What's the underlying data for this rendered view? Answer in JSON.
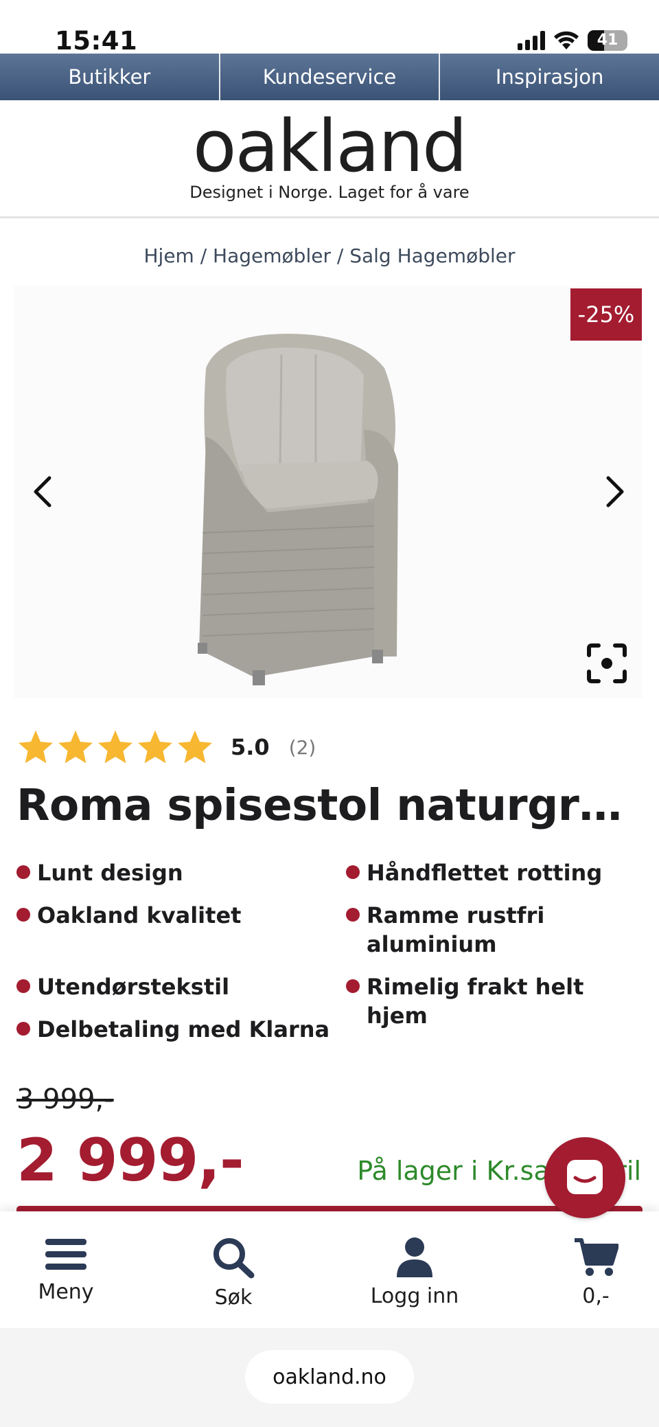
{
  "status_bar": {
    "time": "15:41",
    "battery": "41"
  },
  "top_nav": {
    "items": [
      "Butikker",
      "Kundeservice",
      "Inspirasjon"
    ]
  },
  "header": {
    "logo": "oakland",
    "tagline": "Designet i Norge. Laget for å vare"
  },
  "breadcrumb": "Hjem / Hagemøbler / Salg Hagemøbler",
  "gallery": {
    "discount_badge": "-25%"
  },
  "rating": {
    "stars": 5,
    "value": "5.0",
    "count": "(2)"
  },
  "product": {
    "title": "Roma spisestol naturgrå r...",
    "features": [
      "Lunt design",
      "Håndflettet rotting",
      "Oakland kvalitet",
      "Ramme rustfri aluminium",
      "Utendørstekstil",
      "Rimelig frakt helt hjem",
      "Delbetaling med Klarna"
    ],
    "old_price": "3 999,-",
    "price": "2 999,-",
    "stock": "På lager i Kr.sand ...ril"
  },
  "bottom_nav": {
    "items": [
      "Meny",
      "Søk",
      "Logg inn",
      "0,-"
    ]
  },
  "browser": {
    "url": "oakland.no"
  },
  "colors": {
    "brand_red": "#a31c30",
    "nav_blue": "#4a6285",
    "stock_green": "#2d8a2a",
    "star": "#f7b731"
  }
}
